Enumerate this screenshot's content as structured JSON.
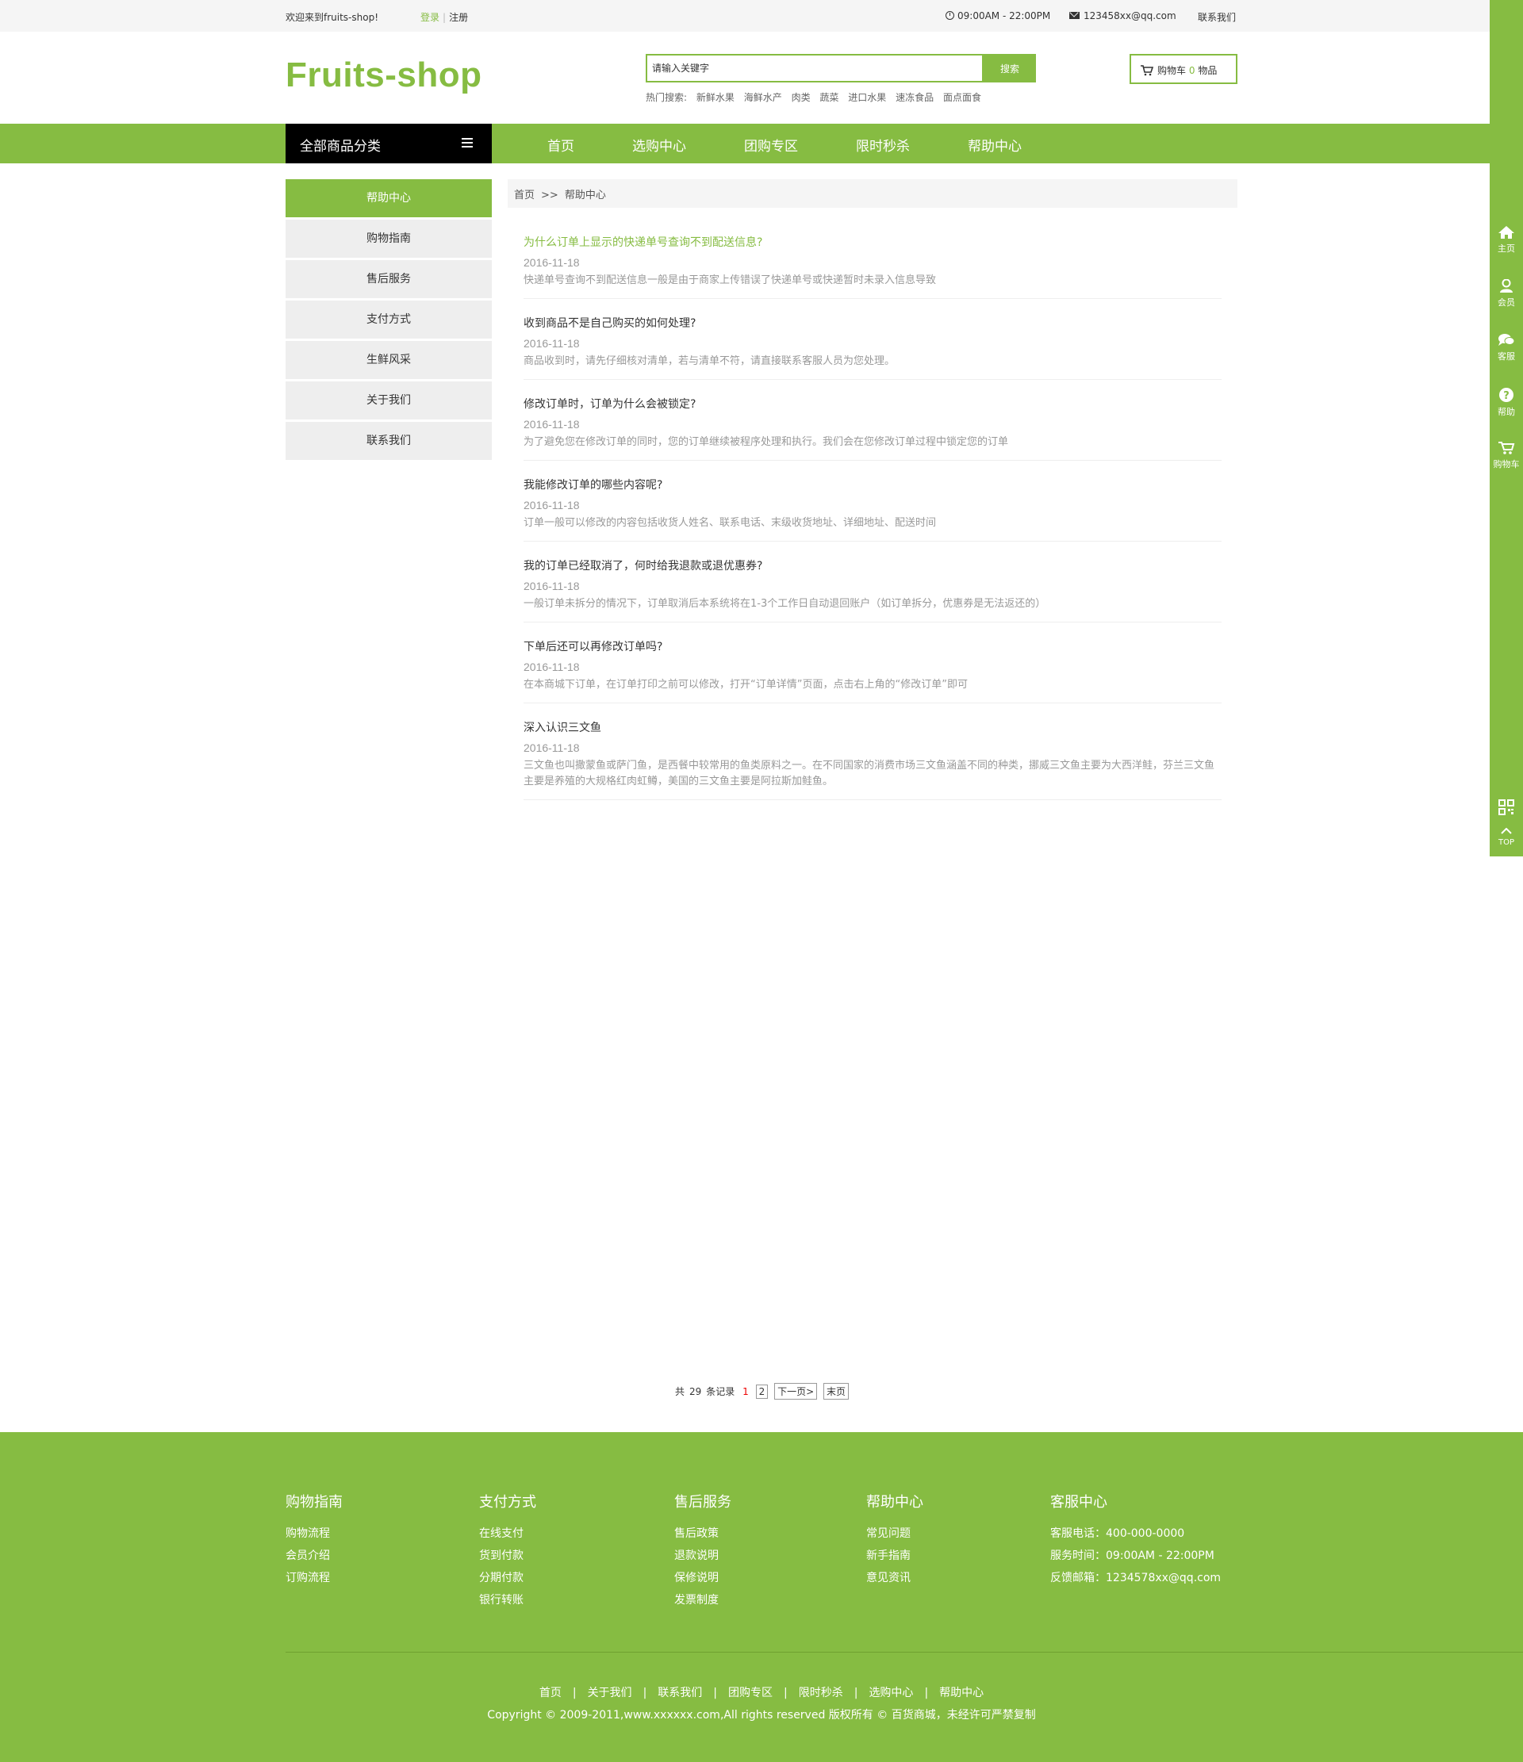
{
  "topbar": {
    "welcome": "欢迎来到fruits-shop!",
    "login": "登录",
    "register": "注册",
    "hours": "09:00AM - 22:00PM",
    "email": "123458xx@qq.com",
    "contact": "联系我们"
  },
  "header": {
    "logo": "Fruits-shop",
    "search_placeholder": "请输入关键字",
    "search_button": "搜索",
    "hot_label": "热门搜索:",
    "hot_terms": [
      "新鲜水果",
      "海鲜水产",
      "肉类",
      "蔬菜",
      "进口水果",
      "速冻食品",
      "面点面食"
    ],
    "cart_label": "购物车",
    "cart_count": "0",
    "cart_unit": "物品"
  },
  "nav": {
    "all_categories": "全部商品分类",
    "links": [
      "首页",
      "选购中心",
      "团购专区",
      "限时秒杀",
      "帮助中心"
    ]
  },
  "sidebar": {
    "items": [
      "帮助中心",
      "购物指南",
      "售后服务",
      "支付方式",
      "生鲜风采",
      "关于我们",
      "联系我们"
    ]
  },
  "breadcrumb": {
    "home": "首页",
    "arrow": ">>",
    "current": "帮助中心"
  },
  "articles": [
    {
      "title": "为什么订单上显示的快递单号查询不到配送信息?",
      "date": "2016-11-18",
      "summary": "快递单号查询不到配送信息一般是由于商家上传错误了快递单号或快递暂时未录入信息导致"
    },
    {
      "title": "收到商品不是自己购买的如何处理?",
      "date": "2016-11-18",
      "summary": "商品收到时，请先仔细核对清单，若与清单不符，请直接联系客服人员为您处理。"
    },
    {
      "title": "修改订单时，订单为什么会被锁定?",
      "date": "2016-11-18",
      "summary": "为了避免您在修改订单的同时，您的订单继续被程序处理和执行。我们会在您修改订单过程中锁定您的订单"
    },
    {
      "title": "我能修改订单的哪些内容呢?",
      "date": "2016-11-18",
      "summary": "订单一般可以修改的内容包括收货人姓名、联系电话、末级收货地址、详细地址、配送时间"
    },
    {
      "title": "我的订单已经取消了，何时给我退款或退优惠券?",
      "date": "2016-11-18",
      "summary": "一般订单未拆分的情况下，订单取消后本系统将在1-3个工作日自动退回账户（如订单拆分，优惠券是无法返还的）"
    },
    {
      "title": "下单后还可以再修改订单吗?",
      "date": "2016-11-18",
      "summary": "在本商城下订单，在订单打印之前可以修改，打开“订单详情”页面，点击右上角的“修改订单”即可"
    },
    {
      "title": "深入认识三文鱼",
      "date": "2016-11-18",
      "summary": "三文鱼也叫撒蒙鱼或萨门鱼，是西餐中较常用的鱼类原料之一。在不同国家的消费市场三文鱼涵盖不同的种类，挪威三文鱼主要为大西洋鲑，芬兰三文鱼主要是养殖的大规格红肉虹鳟，美国的三文鱼主要是阿拉斯加鲑鱼。"
    }
  ],
  "pager": {
    "total_prefix": "共",
    "total": "29",
    "total_suffix": "条记录",
    "current_page": "1",
    "page2": "2",
    "next": "下一页>",
    "last": "末页"
  },
  "right_bar": {
    "items": [
      "主页",
      "会员",
      "客服",
      "帮助",
      "购物车"
    ],
    "top": "TOP"
  },
  "footer": {
    "columns": [
      {
        "title": "购物指南",
        "links": [
          "购物流程",
          "会员介绍",
          "订购流程"
        ]
      },
      {
        "title": "支付方式",
        "links": [
          "在线支付",
          "货到付款",
          "分期付款",
          "银行转账"
        ]
      },
      {
        "title": "售后服务",
        "links": [
          "售后政策",
          "退款说明",
          "保修说明",
          "发票制度"
        ]
      },
      {
        "title": "帮助中心",
        "links": [
          "常见问题",
          "新手指南",
          "意见资讯"
        ]
      },
      {
        "title": "客服中心",
        "links": [
          "客服电话：400-000-0000",
          "服务时间：09:00AM - 22:00PM",
          "反馈邮箱：1234578xx@qq.com"
        ]
      }
    ],
    "bottom_links": [
      "首页",
      "关于我们",
      "联系我们",
      "团购专区",
      "限时秒杀",
      "选购中心",
      "帮助中心"
    ],
    "copyright": "Copyright © 2009-2011,www.xxxxxx.com,All rights reserved 版权所有 © 百货商城，未经许可严禁复制"
  },
  "colors": {
    "brand_green": "#86bc42",
    "nav_black": "#000000",
    "pager_current": "#ee0000"
  }
}
